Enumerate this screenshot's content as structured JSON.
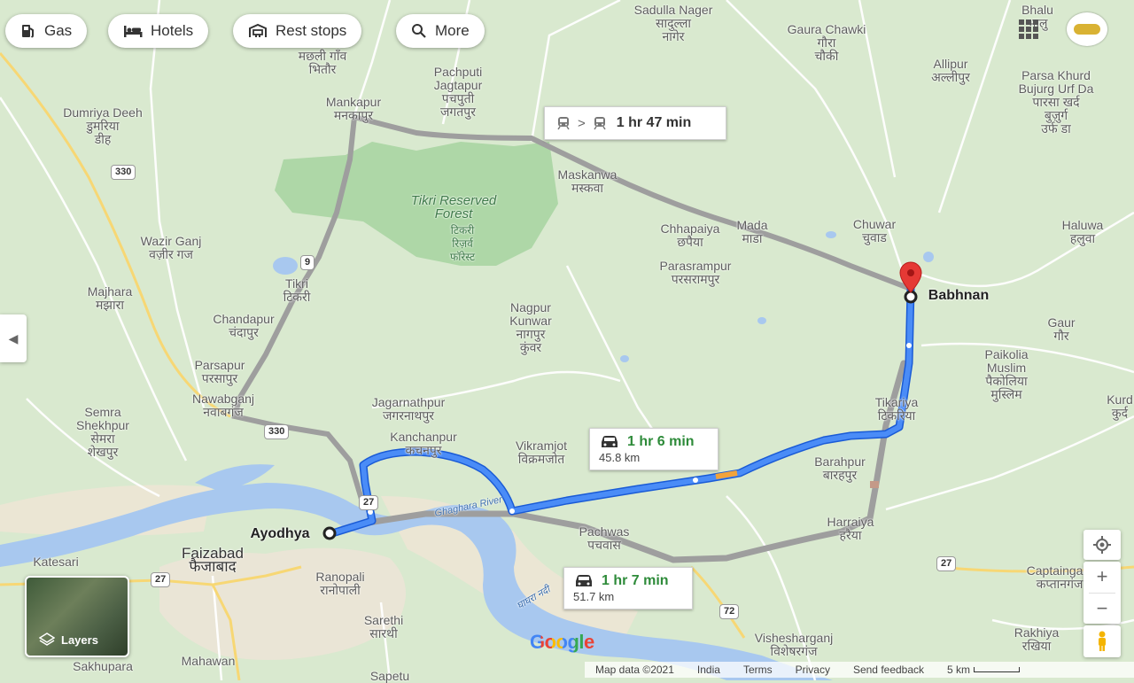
{
  "chips": [
    {
      "label": "Gas",
      "icon": "gas-station-icon"
    },
    {
      "label": "Hotels",
      "icon": "bed-icon"
    },
    {
      "label": "Rest stops",
      "icon": "rest-stop-icon"
    },
    {
      "label": "More",
      "icon": "search-icon"
    }
  ],
  "transit_box": {
    "duration": "1 hr 47 min",
    "separator": ">"
  },
  "route_primary": {
    "duration": "1 hr 6 min",
    "distance": "45.8 km"
  },
  "route_alt": {
    "duration": "1 hr 7 min",
    "distance": "51.7 km"
  },
  "origin": "Ayodhya",
  "destination": "Babhnan",
  "places": [
    {
      "name": "Sadulla Nager",
      "local": "सादुल्ला\nनागेर"
    },
    {
      "name": "Gaura Chawki",
      "local": "गौरा\nचौकी"
    },
    {
      "name": "",
      "local": "मछली गाँव\nभितौर"
    },
    {
      "name": "Pachputi\nJagtapur",
      "local": "पचपुती\nजगतपुर"
    },
    {
      "name": "Mankapur",
      "local": "मनकापुर"
    },
    {
      "name": "Allipur",
      "local": "अल्लीपुर"
    },
    {
      "name": "Parsa Khurd\nBujurg Urf Da",
      "local": "पारसा खर्द\nबुज़ुर्ग\nउर्फ डा"
    },
    {
      "name": "Dumriya Deeh",
      "local": "डुमरिया\nडीह"
    },
    {
      "name": "Maskanwa",
      "local": "मस्कवा"
    },
    {
      "name": "Mada",
      "local": "माडा"
    },
    {
      "name": "Chuwar",
      "local": "चुवाड"
    },
    {
      "name": "Haluwa",
      "local": "हलुवा"
    },
    {
      "name": "Chhapaiya",
      "local": "छपैया"
    },
    {
      "name": "Parasrampur",
      "local": "परसरामपुर"
    },
    {
      "name": "Wazir Ganj",
      "local": "वज़ीर गज"
    },
    {
      "name": "Tikri",
      "local": "टिकरी"
    },
    {
      "name": "Majhara",
      "local": "मझारा"
    },
    {
      "name": "Nagpur\nKunwar",
      "local": "नागपुर\nकुंवर"
    },
    {
      "name": "Chandapur",
      "local": "चंदापुर"
    },
    {
      "name": "Gaur",
      "local": "गौर"
    },
    {
      "name": "Paikolia\nMuslim",
      "local": "पैकोलिया\nमुस्लिम"
    },
    {
      "name": "Parsapur",
      "local": "परसापुर"
    },
    {
      "name": "Nawabganj",
      "local": "नवाबगंज"
    },
    {
      "name": "Jagarnathpur",
      "local": "जगरनाथपुर"
    },
    {
      "name": "Tikariya",
      "local": "टिकरिया"
    },
    {
      "name": "Semra\nShekhpur",
      "local": "सेमरा\nशेखपुर"
    },
    {
      "name": "Kanchanpur",
      "local": "कचनपुर"
    },
    {
      "name": "Vikramjot",
      "local": "विक्रमजोत"
    },
    {
      "name": "Barahpur",
      "local": "बारहपुर"
    },
    {
      "name": "Pachwas",
      "local": "पचवास"
    },
    {
      "name": "Harraiya",
      "local": "हरैया"
    },
    {
      "name": "Faizabad",
      "local": "फैजाबाद"
    },
    {
      "name": "Ranopali",
      "local": "रानोपाली"
    },
    {
      "name": "Captainganj",
      "local": "कप्तानगंज"
    },
    {
      "name": "Sarethi",
      "local": "सारथी"
    },
    {
      "name": "Vishesharganj",
      "local": "विशेषरगंज"
    },
    {
      "name": "Rakhiya",
      "local": "रखिया"
    },
    {
      "name": "Mahawan",
      "local": ""
    },
    {
      "name": "Sakhupara",
      "local": ""
    },
    {
      "name": "Katesari",
      "local": ""
    },
    {
      "name": "Sapetu",
      "local": ""
    },
    {
      "name": "Kurd",
      "local": "कुर्द"
    },
    {
      "name": "Bhalu",
      "local": "भालु"
    }
  ],
  "forest": {
    "name": "Tikri Reserved\nForest",
    "local": "टिकरी\nरिज़र्व\nफॉरेस्ट"
  },
  "rivers": [
    {
      "name": "Ghaghara River"
    },
    {
      "name": "",
      "local": "घाघरा नदी"
    }
  ],
  "highways": [
    "330",
    "9",
    "330",
    "27",
    "27",
    "27",
    "72"
  ],
  "layers_label": "Layers",
  "footer": {
    "map_data": "Map data ©2021",
    "country": "India",
    "terms": "Terms",
    "privacy": "Privacy",
    "feedback": "Send feedback",
    "scale": "5 km"
  },
  "logo": "Google",
  "zoom_in": "+",
  "zoom_out": "−",
  "colors": {
    "route_blue": "#4285f4",
    "route_outline": "#1a5bd6",
    "alt_gray": "#a8a8a8",
    "forest": "#a5d5a0",
    "river": "#a8c8ef",
    "pin_red": "#e53935",
    "land": "#d8e8cf"
  }
}
